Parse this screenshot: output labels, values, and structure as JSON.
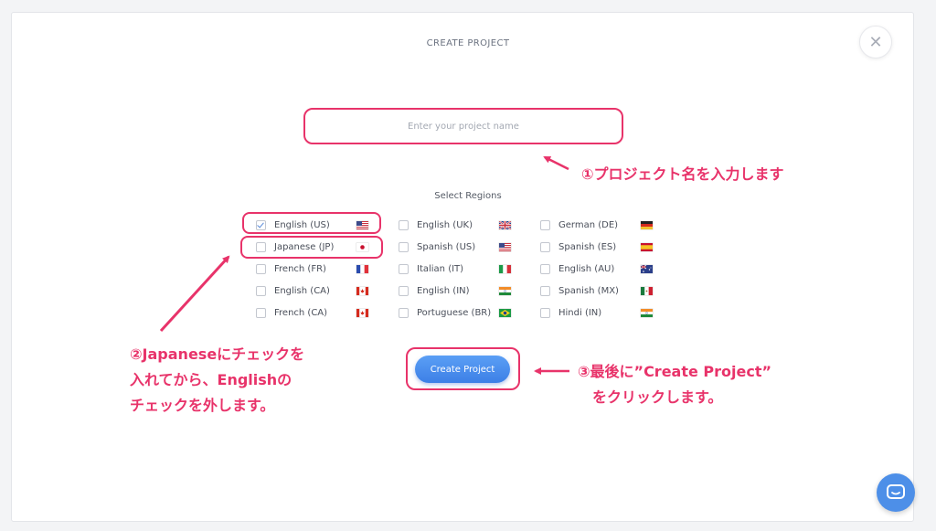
{
  "modal": {
    "title": "CREATE PROJECT",
    "close_icon": "close-icon"
  },
  "project_name": {
    "value": "",
    "placeholder": "Enter your project name"
  },
  "regions": {
    "label": "Select Regions",
    "items": [
      {
        "label": "English (US)",
        "checked": true,
        "flag": "us"
      },
      {
        "label": "English (UK)",
        "checked": false,
        "flag": "uk"
      },
      {
        "label": "German (DE)",
        "checked": false,
        "flag": "de"
      },
      {
        "label": "Japanese (JP)",
        "checked": false,
        "flag": "jp"
      },
      {
        "label": "Spanish (US)",
        "checked": false,
        "flag": "us"
      },
      {
        "label": "Spanish (ES)",
        "checked": false,
        "flag": "es"
      },
      {
        "label": "French (FR)",
        "checked": false,
        "flag": "fr"
      },
      {
        "label": "Italian (IT)",
        "checked": false,
        "flag": "it"
      },
      {
        "label": "English (AU)",
        "checked": false,
        "flag": "au"
      },
      {
        "label": "English (CA)",
        "checked": false,
        "flag": "ca"
      },
      {
        "label": "English (IN)",
        "checked": false,
        "flag": "in"
      },
      {
        "label": "Spanish (MX)",
        "checked": false,
        "flag": "mx"
      },
      {
        "label": "French (CA)",
        "checked": false,
        "flag": "ca"
      },
      {
        "label": "Portuguese (BR)",
        "checked": false,
        "flag": "br"
      },
      {
        "label": "Hindi (IN)",
        "checked": false,
        "flag": "in"
      }
    ]
  },
  "create_button": {
    "label": "Create Project"
  },
  "annotations": {
    "step1": "①プロジェクト名を入力します",
    "step2": [
      "②Japaneseにチェックを",
      "入れてから、Englishの",
      "チェックを外します。"
    ],
    "step3": [
      "③最後に”Create Project”",
      "　をクリックします。"
    ]
  },
  "colors": {
    "accent": "#e8336a",
    "button": "#3c7fe6",
    "chat": "#4d8fe8"
  }
}
